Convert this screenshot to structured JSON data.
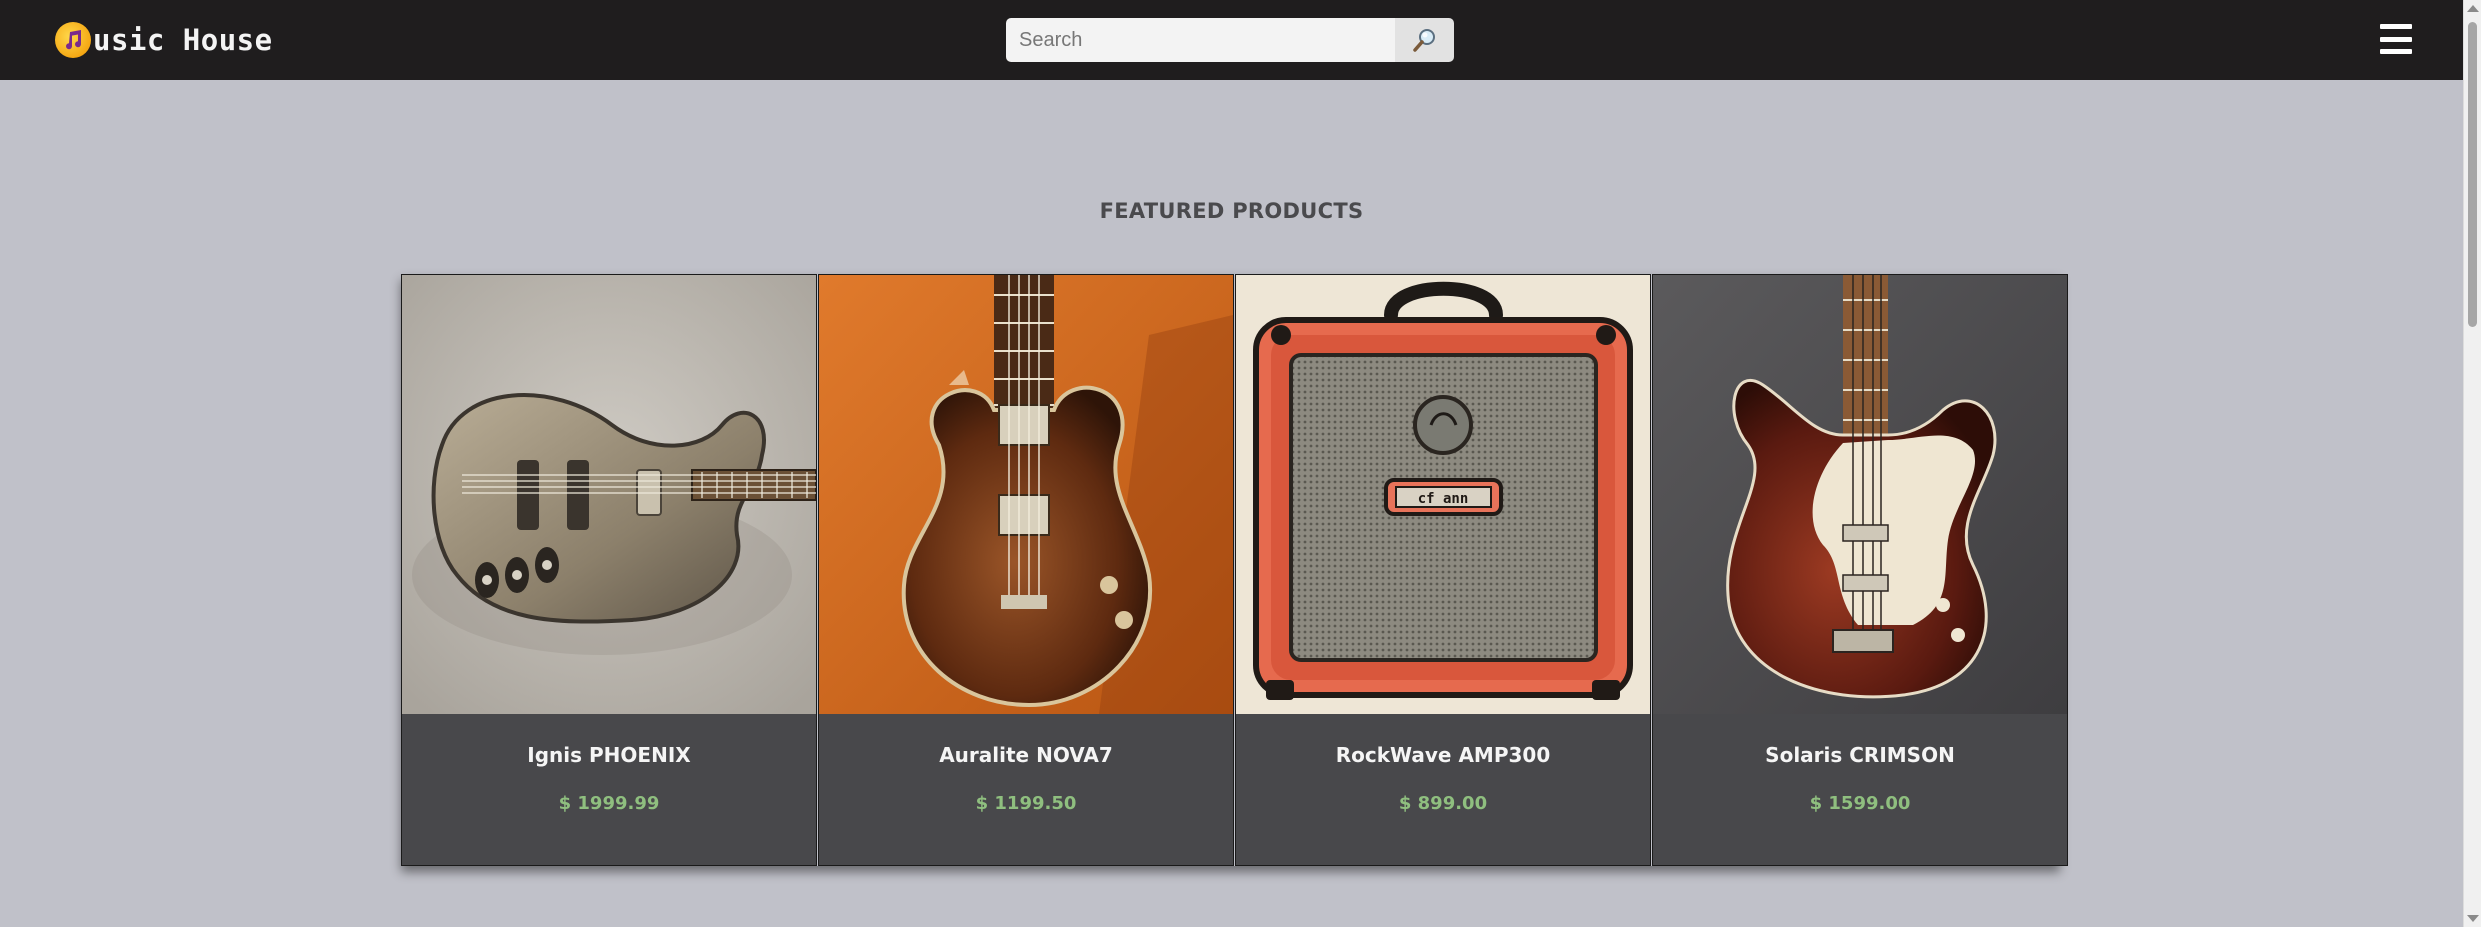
{
  "navbar": {
    "brand_text": "usic House",
    "brand_icon": "music-note-icon",
    "search_placeholder": "Search",
    "search_value": "",
    "search_icon": "magnifier-icon",
    "menu_icon": "hamburger-menu-icon"
  },
  "featured": {
    "title": "FEATURED PRODUCTS",
    "products": [
      {
        "name": "Ignis PHOENIX",
        "price": "$ 1999.99",
        "image": "silver-electric-guitar"
      },
      {
        "name": "Auralite NOVA7",
        "price": "$ 1199.50",
        "image": "brown-electric-guitar-orange-background"
      },
      {
        "name": "RockWave AMP300",
        "price": "$ 899.00",
        "image": "red-guitar-amplifier"
      },
      {
        "name": "Solaris CRIMSON",
        "price": "$ 1599.00",
        "image": "red-white-electric-guitar"
      }
    ]
  },
  "colors": {
    "navbar_bg": "#1f1d1e",
    "page_bg": "#c0c1c9",
    "card_bg": "#48484b",
    "price_color": "#8fbf7f",
    "title_color": "#4a4a4d"
  }
}
